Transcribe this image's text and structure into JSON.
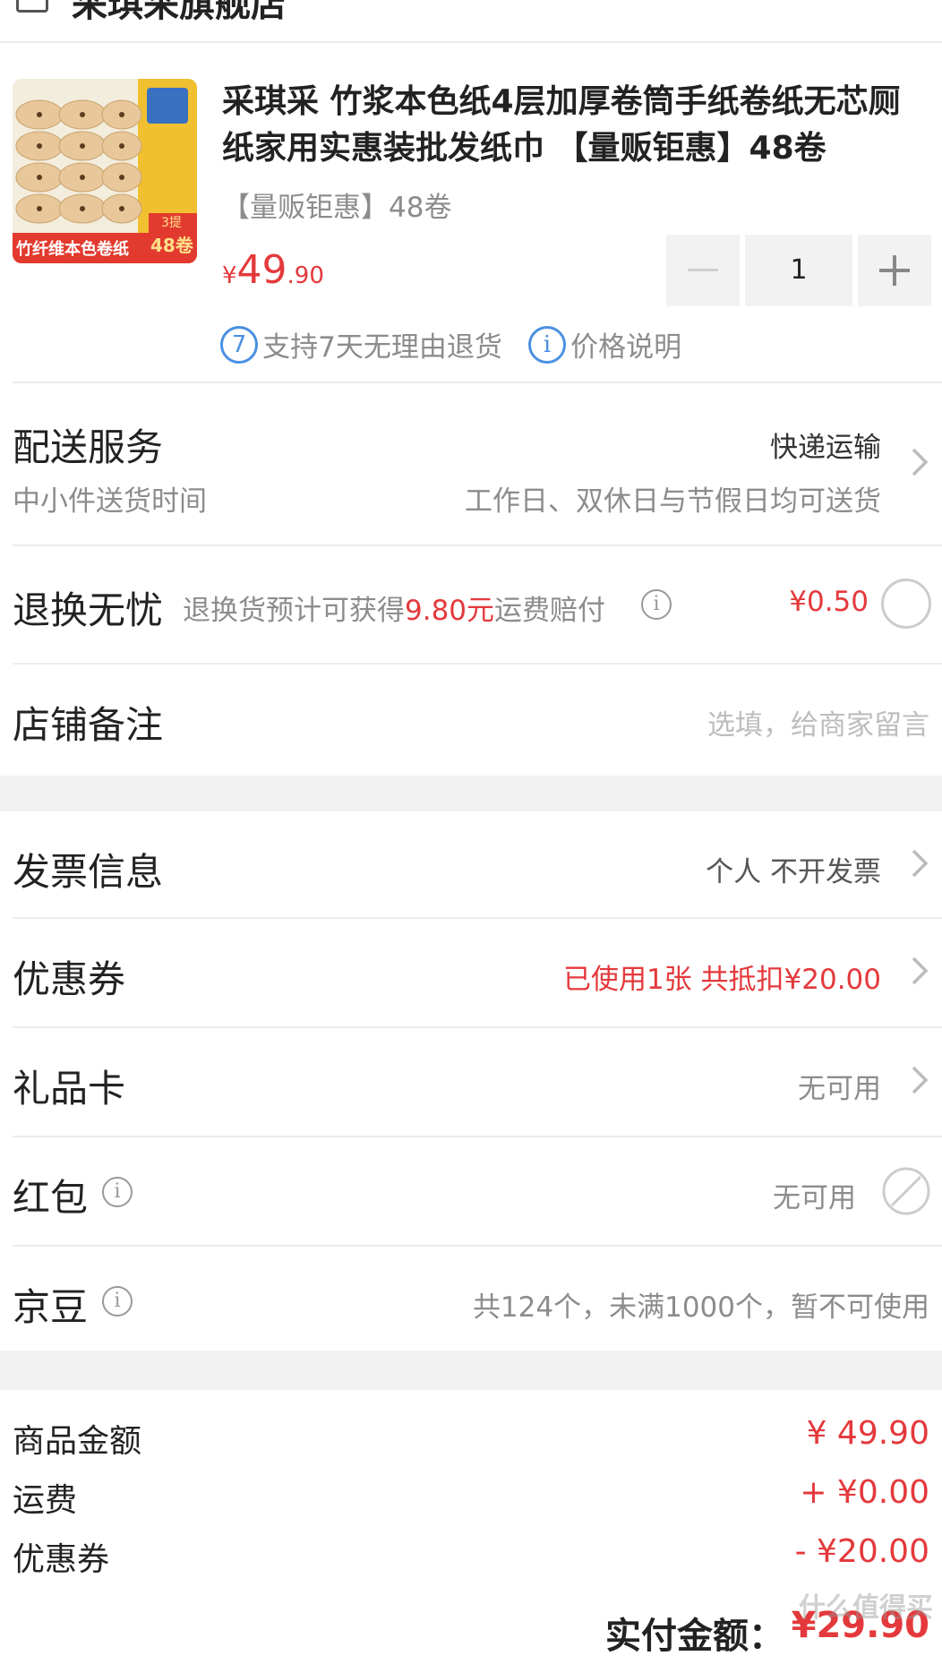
{
  "shop": {
    "name": "采琪采旗舰店"
  },
  "product": {
    "thumb_badge": "竹纤维本色卷纸",
    "thumb_count": "48卷",
    "thumb_top": "3提",
    "title": "采琪采 竹浆本色纸4层加厚卷筒手纸卷纸无芯厕纸家用实惠装批发纸巾 【量贩钜惠】48卷",
    "spec": "【量贩钜惠】48卷",
    "price_symbol": "¥",
    "price_int": "49",
    "price_dec": ".90",
    "quantity": "1",
    "service_return_num": "7",
    "service_return": "支持7天无理由退货",
    "service_price_icon": "i",
    "service_price": "价格说明"
  },
  "delivery": {
    "label": "配送服务",
    "sub_label": "中小件送货时间",
    "method": "快递运输",
    "time": "工作日、双休日与节假日均可送货"
  },
  "return_ins": {
    "label": "退换无忧",
    "desc_pre": "退换货预计可获得",
    "desc_amount": "9.80元",
    "desc_post": "运费赔付",
    "price": "¥0.50"
  },
  "remark": {
    "label": "店铺备注",
    "placeholder": "选填，给商家留言"
  },
  "invoice": {
    "label": "发票信息",
    "value": "个人 不开发票"
  },
  "coupon": {
    "label": "优惠券",
    "value": "已使用1张 共抵扣¥20.00"
  },
  "gift_card": {
    "label": "礼品卡",
    "value": "无可用"
  },
  "red_packet": {
    "label": "红包",
    "value": "无可用"
  },
  "jingdou": {
    "label": "京豆",
    "value": "共124个，未满1000个，暂不可使用"
  },
  "summary": {
    "items": [
      {
        "label": "商品金额",
        "value": "¥ 49.90"
      },
      {
        "label": "运费",
        "value": "+ ¥0.00"
      },
      {
        "label": "优惠券",
        "value": "- ¥20.00"
      }
    ],
    "total_label": "实付金额：",
    "total_value": "¥29.90"
  },
  "watermark": "什么值得买",
  "colors": {
    "accent": "#e4393c",
    "blue": "#4a90e2",
    "bg": "#f2f2f2"
  }
}
